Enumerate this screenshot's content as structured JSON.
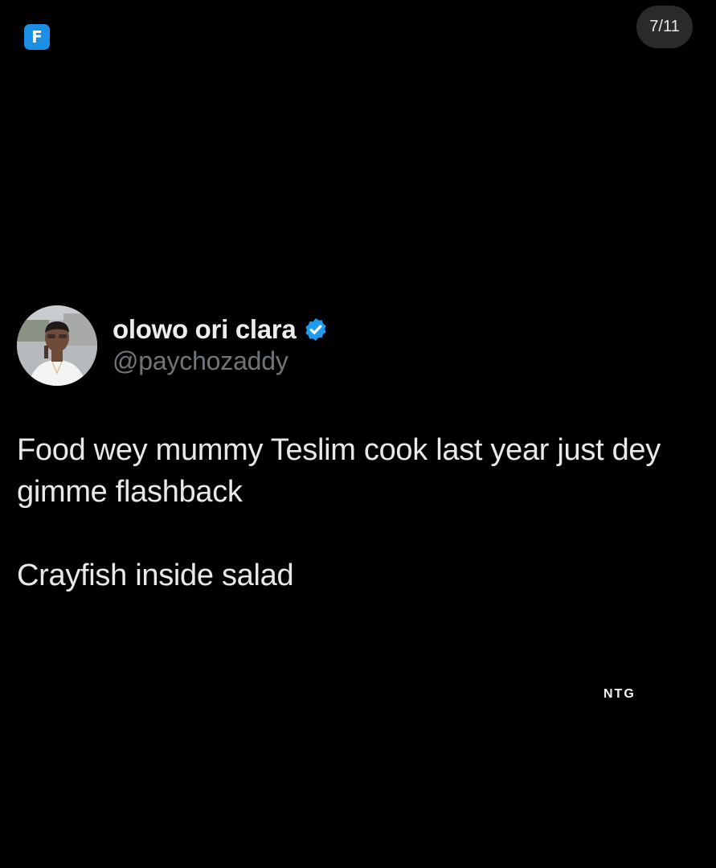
{
  "header": {
    "logo_letter": "F",
    "page_counter": "7/11"
  },
  "tweet": {
    "display_name": "olowo ori clara",
    "handle": "@paychozaddy",
    "verified": true,
    "text_paragraphs": [
      "Food wey mummy Teslim cook last year just dey gimme flashback",
      "Crayfish inside salad"
    ]
  },
  "watermark": {
    "text": "NTG"
  },
  "colors": {
    "background": "#000000",
    "logo_blue": "#1a8fe3",
    "verified_blue": "#1d9bf0",
    "handle_grey": "#71767b",
    "text_white": "#e7e9ea",
    "counter_pill": "#2a2a2a"
  },
  "icons": {
    "verified": "verified-check-icon",
    "logo": "app-logo-icon"
  }
}
